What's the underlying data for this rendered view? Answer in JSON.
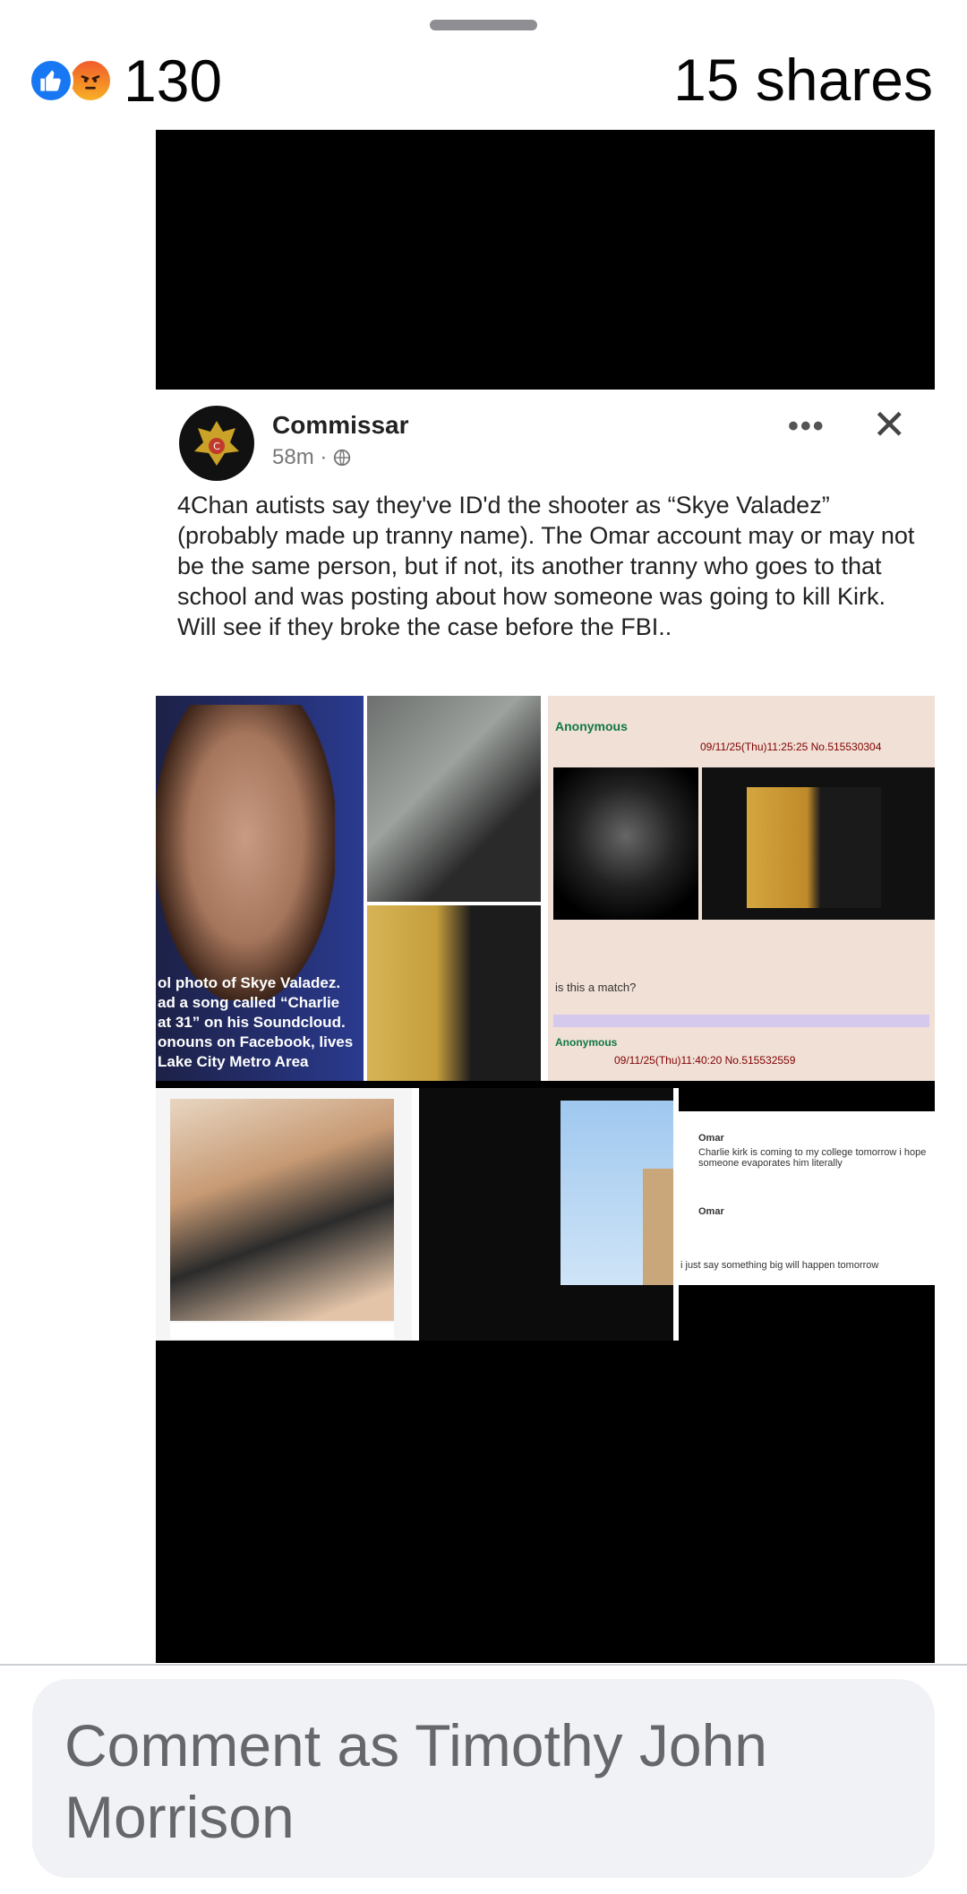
{
  "reactions": {
    "icons": [
      "like-icon",
      "angry-icon"
    ],
    "count": "130"
  },
  "shares": "15 shares",
  "post": {
    "author": "Commissar",
    "time": "58m ·",
    "text": "4Chan autists say they've ID'd the shooter as “Skye Valadez” (probably made up tranny name). The Omar account may or may not be the same person, but if not, its another tranny who goes to that school and was posting about how someone was going to kill Kirk. Will see if they broke the case before the FBI..",
    "yearbook_caption": "ol photo of Skye Valadez.\nad a song called “Charlie\nat 31” on his Soundcloud.\nonouns on Facebook, lives\n Lake City Metro Area",
    "chan": {
      "poster": "Anonymous",
      "date1": "09/11/25(Thu)11:25:25 No.515530304",
      "question": "is this a match?",
      "date2": "09/11/25(Thu)11:40:20 No.515532559"
    },
    "tweet": {
      "user": "Omar",
      "line1": "Charlie kirk is coming to my college tomorrow i hope someone evaporates him literally",
      "line2": "i just say something big will happen tomorrow"
    }
  },
  "comment": {
    "placeholder": "Comment as Timothy John Morrison"
  },
  "colors": {
    "like": "#1877f2",
    "angry": "#f15b2b",
    "comment_bg": "#f0f2f5",
    "placeholder": "#65676b"
  }
}
